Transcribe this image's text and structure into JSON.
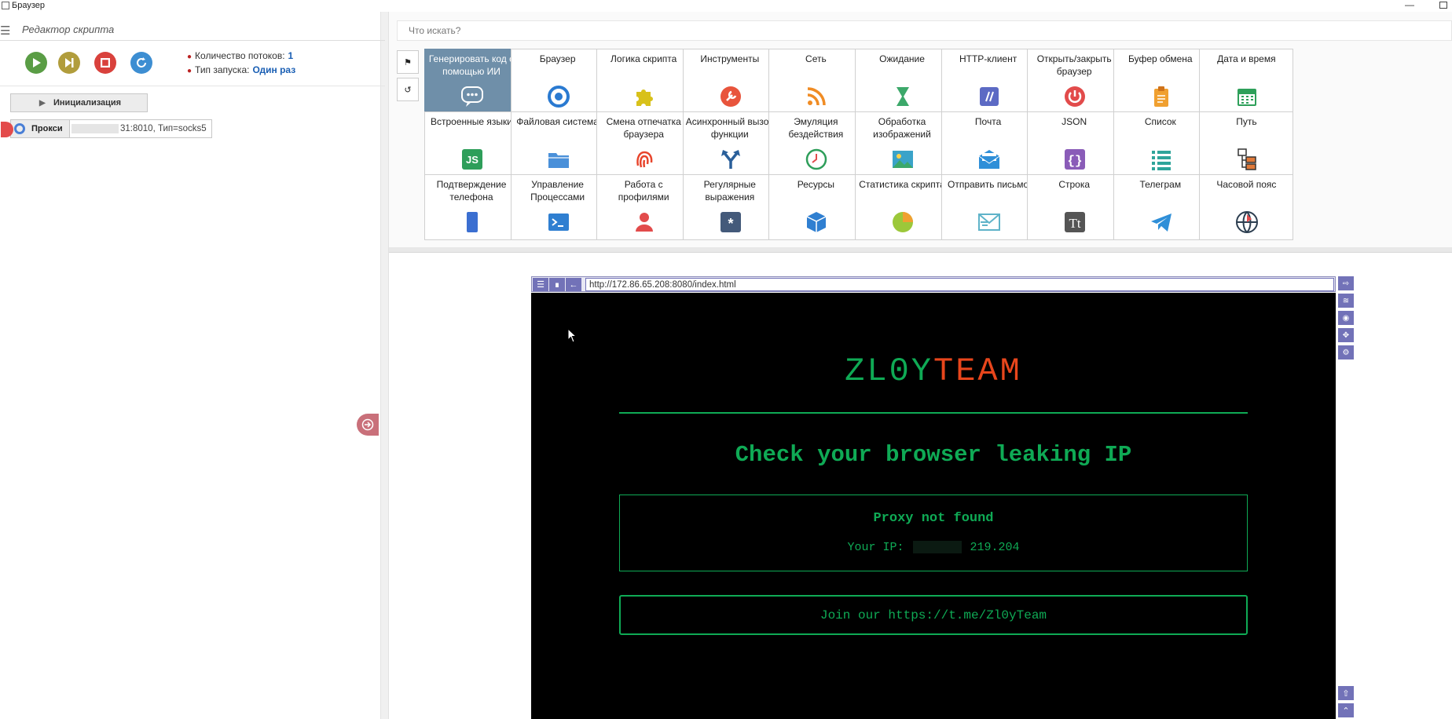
{
  "window": {
    "title": "Браузер"
  },
  "editor": {
    "title": "Редактор скрипта"
  },
  "run_meta": {
    "threads_label": "Количество потоков:",
    "threads_value": "1",
    "run_type_label": "Тип запуска:",
    "run_type_value": "Один раз"
  },
  "actions": [
    {
      "label": "Инициализация"
    },
    {
      "label": "Прокси",
      "value": "31:8010",
      "type_text": "Тип=socks5"
    }
  ],
  "search": {
    "placeholder": "Что искать?"
  },
  "tiles": [
    {
      "label": "Генерировать код с помощью ИИ",
      "icon": "chat-bubble-icon",
      "color": "#ffffff",
      "selected": true
    },
    {
      "label": "Браузер",
      "icon": "chrome-icon",
      "color": "#2a7ad1"
    },
    {
      "label": "Логика скрипта",
      "icon": "puzzle-icon",
      "color": "#d8c11a"
    },
    {
      "label": "Инструменты",
      "icon": "wrench-icon",
      "color": "#e8543c"
    },
    {
      "label": "Сеть",
      "icon": "rss-icon",
      "color": "#f08c24"
    },
    {
      "label": "Ожидание",
      "icon": "hourglass-icon",
      "color": "#3ca86a"
    },
    {
      "label": "HTTP-клиент",
      "icon": "slashes-icon",
      "color": "#5c6ac4"
    },
    {
      "label": "Открыть/закрыть браузер",
      "icon": "power-icon",
      "color": "#e24b4b"
    },
    {
      "label": "Буфер обмена",
      "icon": "clipboard-icon",
      "color": "#f0a030"
    },
    {
      "label": "Дата и время",
      "icon": "calendar-icon",
      "color": "#2ea05a"
    },
    {
      "label": "Встроенные языки",
      "icon": "js-icon",
      "color": "#2e9e5a"
    },
    {
      "label": "Файловая система",
      "icon": "folder-icon",
      "color": "#4a90d9"
    },
    {
      "label": "Смена отпечатка браузера",
      "icon": "fingerprint-icon",
      "color": "#e8452c"
    },
    {
      "label": "Асинхронный вызов функции",
      "icon": "fork-arrow-icon",
      "color": "#2a5f9a"
    },
    {
      "label": "Эмуляция бездействия",
      "icon": "clock-icon",
      "color": "#2e9e5a"
    },
    {
      "label": "Обработка изображений",
      "icon": "image-icon",
      "color": "#3aa3c9"
    },
    {
      "label": "Почта",
      "icon": "mail-icon",
      "color": "#2f8fd8"
    },
    {
      "label": "JSON",
      "icon": "braces-icon",
      "color": "#8a5cb8"
    },
    {
      "label": "Список",
      "icon": "list-icon",
      "color": "#2ea49a"
    },
    {
      "label": "Путь",
      "icon": "tree-path-icon",
      "color": "#e07a3a"
    },
    {
      "label": "Подтверждение телефона",
      "icon": "phone-icon",
      "color": "#3b6fd1"
    },
    {
      "label": "Управление Процессами",
      "icon": "terminal-icon",
      "color": "#2f7fd1"
    },
    {
      "label": "Работа с профилями",
      "icon": "user-icon",
      "color": "#e24b4b"
    },
    {
      "label": "Регулярные выражения",
      "icon": "asterisk-icon",
      "color": "#445a7a"
    },
    {
      "label": "Ресурсы",
      "icon": "cube-icon",
      "color": "#2f7fd1"
    },
    {
      "label": "Статистика скрипта",
      "icon": "pie-icon",
      "color": "#9cc83a"
    },
    {
      "label": "Отправить письмо",
      "icon": "send-icon",
      "color": "#5fb3c9"
    },
    {
      "label": "Строка",
      "icon": "text-icon",
      "color": "#555555"
    },
    {
      "label": "Телеграм",
      "icon": "telegram-icon",
      "color": "#2f8fd8"
    },
    {
      "label": "Часовой пояс",
      "icon": "globe-icon",
      "color": "#2c3e50"
    }
  ],
  "browser": {
    "url": "http://172.86.65.208:8080/index.html",
    "brand_a": "ZL0Y",
    "brand_b": "TEAM",
    "headline": "Check your browser leaking IP",
    "proxy_status": "Proxy not found",
    "ip_label": "Your IP:",
    "ip_value": "219.204",
    "join_text": "Join our https://t.me/Zl0yTeam"
  },
  "colors": {
    "accent_green": "#0faa55",
    "brand_red": "#e8461c",
    "tile_selected": "#6f8fa9",
    "nav_purple": "#7272b8"
  }
}
